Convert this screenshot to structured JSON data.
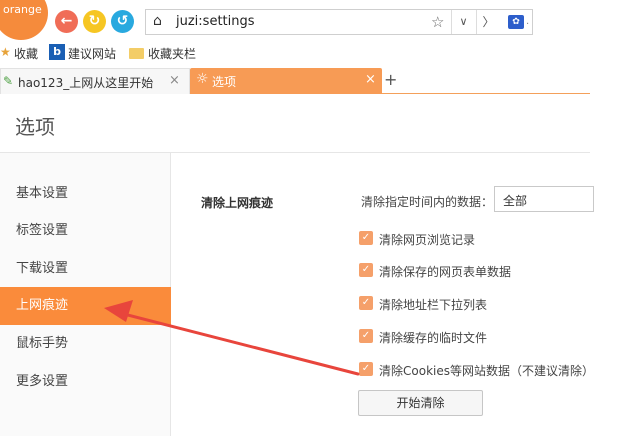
{
  "browser": {
    "logo_text": "orange",
    "address": "juzi:settings",
    "bookmarks": [
      {
        "label": "收藏"
      },
      {
        "label": "建议网站"
      },
      {
        "label": "收藏夹栏"
      }
    ],
    "tabs": [
      {
        "label": "hao123_上网从这里开始",
        "active": false
      },
      {
        "label": "选项",
        "active": true
      }
    ]
  },
  "page": {
    "title": "选项",
    "sidebar": [
      {
        "label": "基本设置",
        "active": false
      },
      {
        "label": "标签设置",
        "active": false
      },
      {
        "label": "下载设置",
        "active": false
      },
      {
        "label": "上网痕迹",
        "active": true
      },
      {
        "label": "鼠标手势",
        "active": false
      },
      {
        "label": "更多设置",
        "active": false
      }
    ],
    "section_title": "清除上网痕迹",
    "time_range": {
      "label": "清除指定时间内的数据：",
      "value": "全部"
    },
    "options": [
      {
        "label": "清除网页浏览记录",
        "checked": true
      },
      {
        "label": "清除保存的网页表单数据",
        "checked": true
      },
      {
        "label": "清除地址栏下拉列表",
        "checked": true
      },
      {
        "label": "清除缓存的临时文件",
        "checked": true
      },
      {
        "label": "清除Cookies等网站数据（不建议清除）",
        "checked": true
      }
    ],
    "start_button": "开始清除"
  },
  "colors": {
    "accent": "#fa8b3b",
    "tab_active": "#f79b55",
    "annotation_arrow": "#e8453c"
  }
}
